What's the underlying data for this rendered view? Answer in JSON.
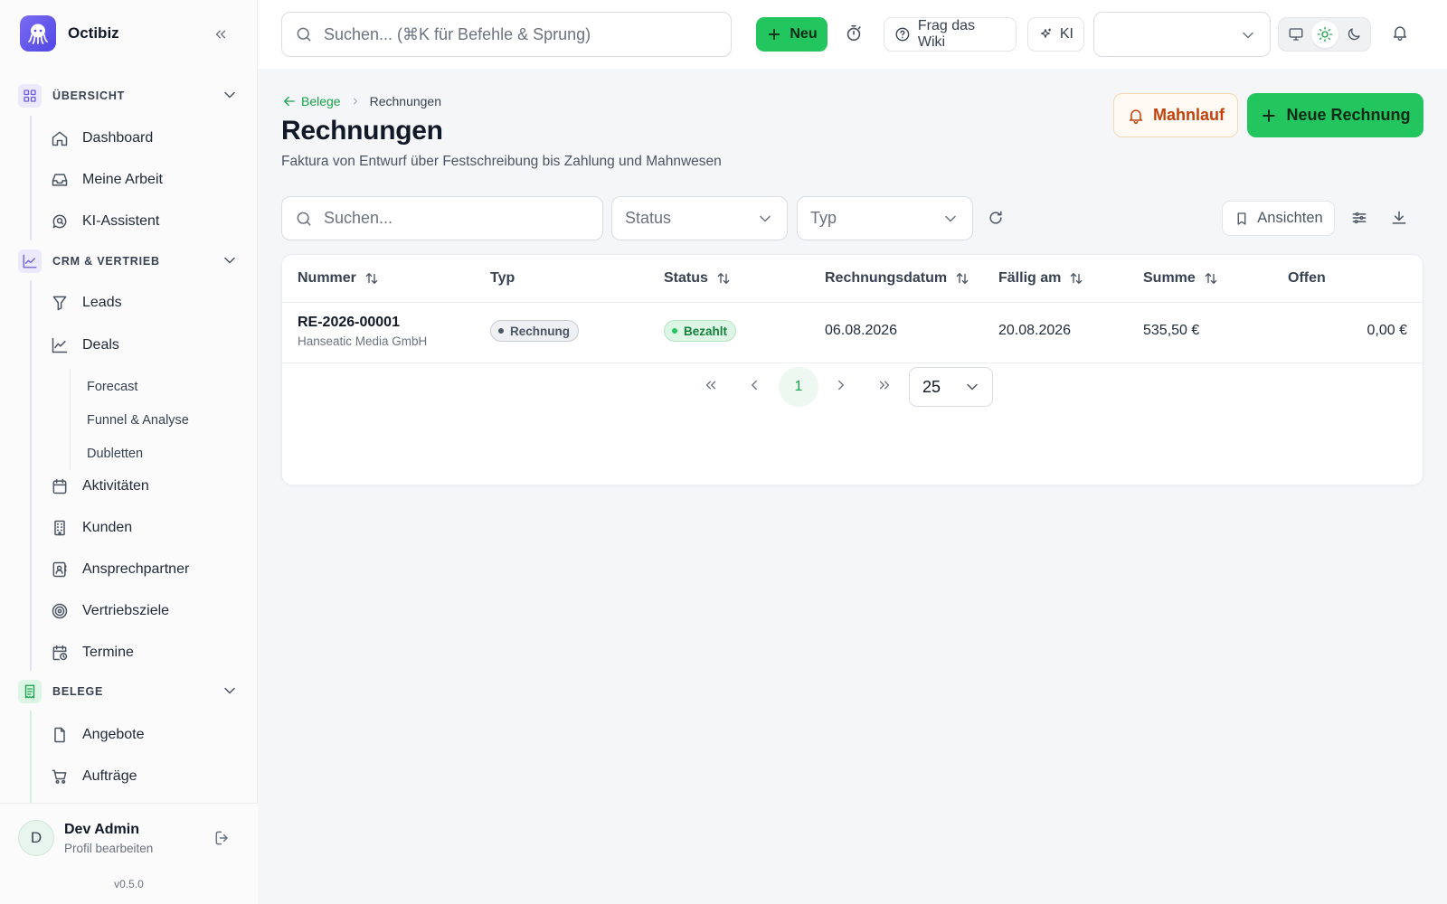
{
  "app": {
    "name": "Octibiz",
    "version": "v0.5.0"
  },
  "topbar": {
    "search_placeholder": "Suchen... (⌘K für Befehle & Sprung)",
    "new_label": "Neu",
    "wiki_label": "Frag das Wiki",
    "ai_label": "KI",
    "workspace_select_value": ""
  },
  "sidebar": {
    "sections": [
      {
        "label": "ÜBERSICHT",
        "items": [
          "Dashboard",
          "Meine Arbeit",
          "KI-Assistent"
        ]
      },
      {
        "label": "CRM & VERTRIEB",
        "items": [
          "Leads",
          "Deals",
          "Aktivitäten",
          "Kunden",
          "Ansprechpartner",
          "Vertriebsziele",
          "Termine"
        ],
        "deals_subitems": [
          "Forecast",
          "Funnel & Analyse",
          "Dubletten"
        ]
      },
      {
        "label": "BELEGE",
        "items": [
          "Angebote",
          "Aufträge"
        ]
      }
    ]
  },
  "user": {
    "initial": "D",
    "name": "Dev Admin",
    "subtitle": "Profil bearbeiten"
  },
  "page": {
    "breadcrumb_back": "Belege",
    "breadcrumb_current": "Rechnungen",
    "title": "Rechnungen",
    "subtitle": "Faktura von Entwurf über Festschreibung bis Zahlung und Mahnwesen",
    "mahnlauf_label": "Mahnlauf",
    "new_invoice_label": "Neue Rechnung"
  },
  "filters": {
    "search_placeholder": "Suchen...",
    "status_placeholder": "Status",
    "type_placeholder": "Typ",
    "views_label": "Ansichten"
  },
  "table": {
    "columns": [
      "Nummer",
      "Typ",
      "Status",
      "Rechnungsdatum",
      "Fällig am",
      "Summe",
      "Offen"
    ],
    "rows": [
      {
        "number": "RE-2026-00001",
        "customer": "Hanseatic Media GmbH",
        "type": "Rechnung",
        "status": "Bezahlt",
        "invoice_date": "06.08.2026",
        "due_date": "20.08.2026",
        "total": "535,50 €",
        "open": "0,00 €"
      }
    ]
  },
  "pagination": {
    "current_page": "1",
    "page_size": "25"
  },
  "colors": {
    "primary": "#22c55e",
    "primary_text": "#16a34a",
    "warning": "#c2410c",
    "accent_purple": "#6d5ce8"
  }
}
